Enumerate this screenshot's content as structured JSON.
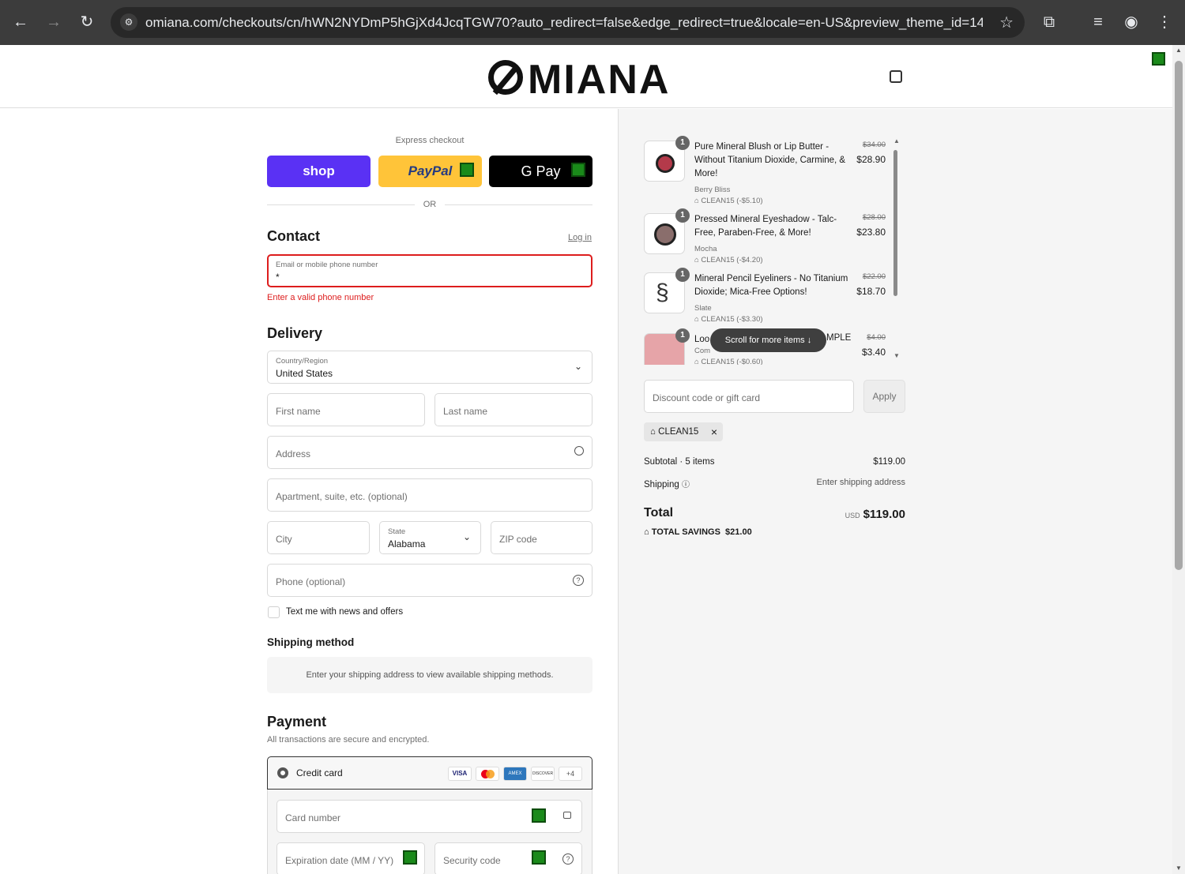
{
  "browser": {
    "url": "omiana.com/checkouts/cn/hWN2NYDmP5hGjXd4JcqTGW70?auto_redirect=false&edge_redirect=true&locale=en-US&preview_theme_id=14811..."
  },
  "header": {
    "logo": "MIANA"
  },
  "express": {
    "title": "Express checkout",
    "shop_label": "shop",
    "paypal_label": "PayPal",
    "gpay_label": "G Pay",
    "or_label": "OR"
  },
  "contact": {
    "heading": "Contact",
    "login_label": "Log in",
    "email_label": "Email or mobile phone number",
    "email_value": "*",
    "error": "Enter a valid phone number"
  },
  "delivery": {
    "heading": "Delivery",
    "country_label": "Country/Region",
    "country_value": "United States",
    "first_name": "First name",
    "last_name": "Last name",
    "address": "Address",
    "apartment": "Apartment, suite, etc. (optional)",
    "city": "City",
    "state_label": "State",
    "state_value": "Alabama",
    "zip": "ZIP code",
    "phone": "Phone (optional)",
    "text_me": "Text me with news and offers"
  },
  "shipping_method": {
    "heading": "Shipping method",
    "message": "Enter your shipping address to view available shipping methods."
  },
  "payment": {
    "heading": "Payment",
    "subtitle": "All transactions are secure and encrypted.",
    "credit_card": "Credit card",
    "more_cards": "+4",
    "card_number": "Card number",
    "expiration": "Expiration date (MM / YY)",
    "security": "Security code",
    "card_brands": [
      "VISA",
      "MC",
      "AMEX",
      "DISCOVER"
    ]
  },
  "cart": {
    "items": [
      {
        "qty": "1",
        "name": "Pure Mineral Blush or Lip Butter - Without Titanium Dioxide, Carmine, & More!",
        "variant": "Berry Bliss",
        "discount": "CLEAN15 (-$5.10)",
        "old_price": "$34.00",
        "price": "$28.90"
      },
      {
        "qty": "1",
        "name": "Pressed Mineral Eyeshadow - Talc-Free, Paraben-Free, & More!",
        "variant": "Mocha",
        "discount": "CLEAN15 (-$4.20)",
        "old_price": "$28.00",
        "price": "$23.80"
      },
      {
        "qty": "1",
        "name": "Mineral Pencil Eyeliners - No Titanium Dioxide; Mica-Free Options!",
        "variant": "Slate",
        "discount": "CLEAN15 (-$3.30)",
        "old_price": "$22.00",
        "price": "$18.70"
      },
      {
        "qty": "1",
        "name": "Loo",
        "name_tail": "MPLE",
        "variant": "Com",
        "discount": "CLEAN15 (-$0.60)",
        "old_price": "$4.00",
        "price": "$3.40"
      }
    ],
    "scroll_hint": "Scroll for more items",
    "discount_placeholder": "Discount code or gift card",
    "apply_label": "Apply",
    "applied_code": "CLEAN15",
    "subtotal_label": "Subtotal · 5 items",
    "subtotal_value": "$119.00",
    "shipping_label": "Shipping",
    "shipping_value": "Enter shipping address",
    "total_label": "Total",
    "currency": "USD",
    "total_value": "$119.00",
    "savings_label": "TOTAL SAVINGS",
    "savings_value": "$21.00"
  },
  "colors": {
    "shop": "#5a31f4",
    "paypal": "#ffc439",
    "error": "#dd1d1d",
    "accent_green": "#1a8a1a"
  }
}
